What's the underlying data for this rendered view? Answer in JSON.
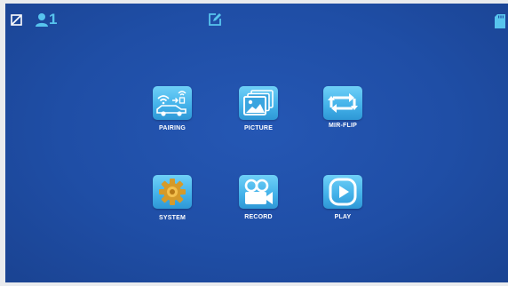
{
  "status_bar": {
    "sd_card_icon": "sd-card-slash-icon",
    "user_icon": "user-icon",
    "user_count": "1",
    "edit_icon": "edit-icon",
    "memory_card_icon": "memory-card-icon"
  },
  "menu": {
    "items": [
      {
        "label": "PAIRING",
        "icon": "wireless-car-icon"
      },
      {
        "label": "PICTURE",
        "icon": "photo-gallery-icon"
      },
      {
        "label": "MIR-FLIP",
        "icon": "flip-arrows-icon"
      },
      {
        "label": "SYSTEM",
        "icon": "gear-icon"
      },
      {
        "label": "RECORD",
        "icon": "video-camera-icon"
      },
      {
        "label": "PLAY",
        "icon": "play-icon"
      }
    ]
  },
  "colors": {
    "background": "#1f4ea6",
    "tile": "#45b3ea",
    "accent": "#57c4ee",
    "gear": "#d59a2a"
  }
}
